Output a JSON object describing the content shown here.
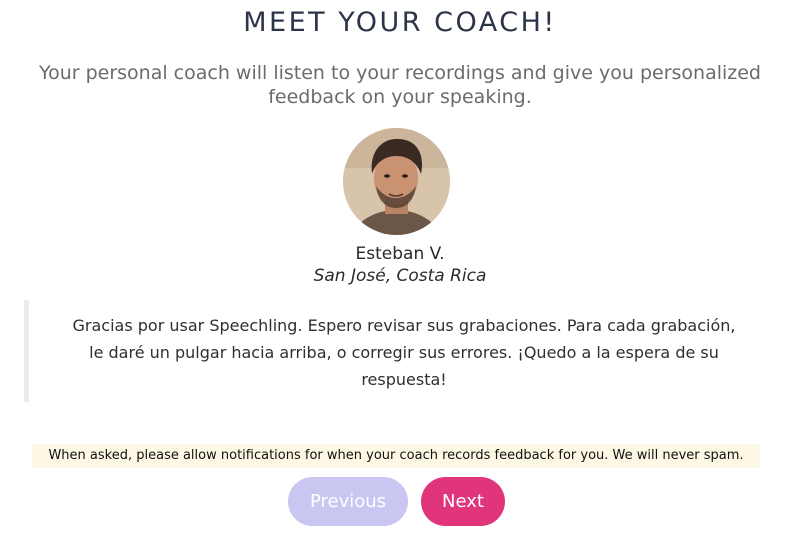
{
  "header": {
    "title": "MEET YOUR COACH!",
    "subtitle": "Your personal coach will listen to your recordings and give you personalized feedback on your speaking."
  },
  "coach": {
    "name": "Esteban V.",
    "location": "San José, Costa Rica",
    "message": "Gracias por usar Speechling. Espero revisar sus grabaciones. Para cada grabación, le daré un pulgar hacia arriba, o corregir sus errores. ¡Quedo a la espera de su respuesta!"
  },
  "notice": {
    "text": "When asked, please allow notifications for when your coach records feedback for you. We will never spam."
  },
  "navigation": {
    "previous_label": "Previous",
    "next_label": "Next"
  },
  "colors": {
    "title": "#2c3448",
    "notice_background": "#fcf8e3",
    "previous_button": "#c9c6f2",
    "next_button": "#e0357a"
  }
}
